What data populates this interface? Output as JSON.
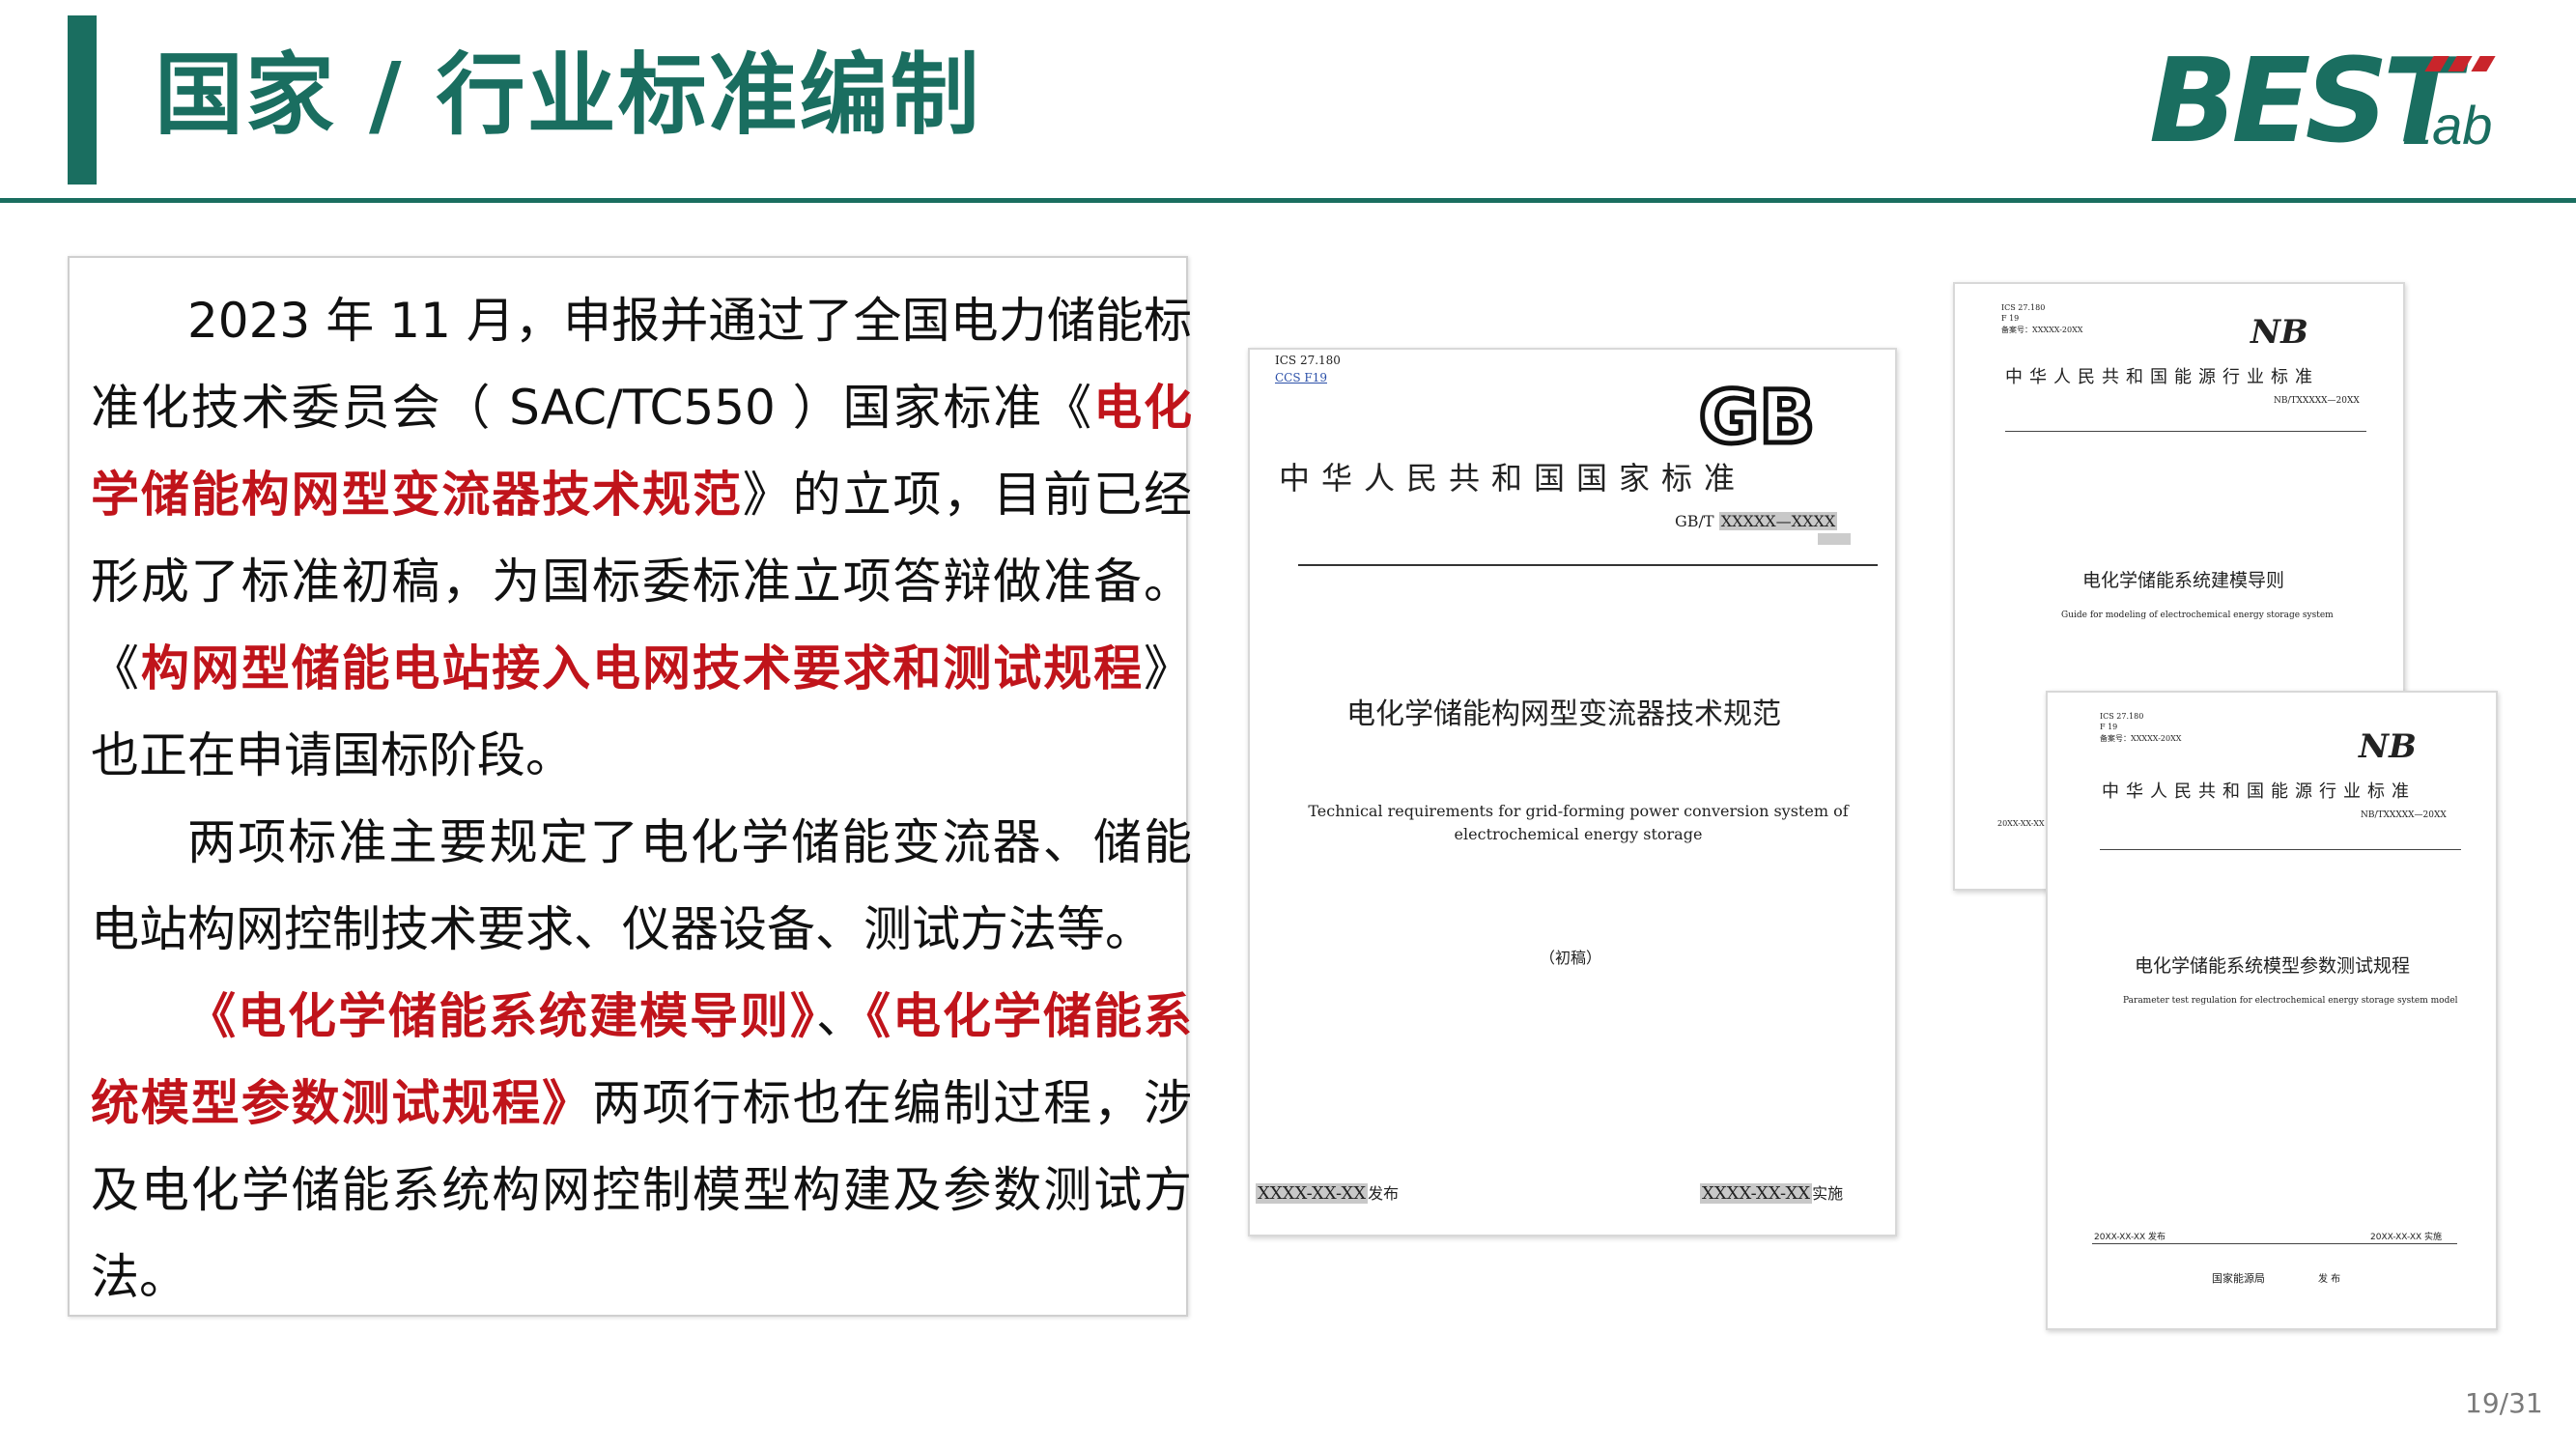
{
  "header": {
    "title": "国家 / 行业标准编制",
    "logo_text_main": "BEST",
    "logo_text_sub": "Lab",
    "accent_color": "#1a6e60",
    "logo_stripe_color": "#c9252b"
  },
  "body": {
    "p1": {
      "t1": "2023 年 11 月，申报并通过了全国电力储能标准化技术委员会（ SAC/TC550 ）国家标准《",
      "r1": "电化学储能构网型变流器技术规范",
      "t2": "》的立项，目前已经形成了标准初稿，为国标委标准立项答辩做准备。《",
      "r2": "构网型储能电站接入电网技术要求和测试规程",
      "t3": "》也正在申请国标阶段。"
    },
    "p2": "两项标准主要规定了电化学储能变流器、储能电站构网控制技术要求、仪器设备、测试方法等。",
    "p3": {
      "r1": "《电化学储能系统建模导则》",
      "t1": "、",
      "r2": "《电化学储能系统模型参数测试规程》",
      "t2": "两项行标也在编制过程，涉及电化学储能系统构网控制模型构建及参数测试方法。"
    },
    "highlight_color": "#c0141b"
  },
  "documents": {
    "gb": {
      "ics": "ICS 27.180",
      "ccs": "CCS  F19",
      "logo": "GB",
      "authority": "中华人民共和国国家标准",
      "number_prefix": "GB/T",
      "number_value": "XXXXX—XXXX",
      "title_cn": "电化学储能构网型变流器技术规范",
      "title_en": "Technical requirements for grid-forming power conversion system of electrochemical energy storage",
      "draft_label": "（初稿）",
      "issue_date": "XXXX-XX-XX",
      "issue_label": "发布",
      "impl_date": "XXXX-XX-XX",
      "impl_label": "实施"
    },
    "nb1": {
      "ics": "ICS 27.180",
      "ccs": "F 19",
      "record": "备案号：XXXXX-20XX",
      "logo": "NB",
      "authority": "中华人民共和国能源行业标准",
      "number": "NB/TXXXXX—20XX",
      "title_cn": "电化学储能系统建模导则",
      "title_en": "Guide for modeling of electrochemical energy storage system",
      "issue_date_partial": "20XX-XX-XX"
    },
    "nb2": {
      "ics": "ICS 27.180",
      "ccs": "F 19",
      "record": "备案号：XXXXX-20XX",
      "logo": "NB",
      "authority": "中华人民共和国能源行业标准",
      "number": "NB/TXXXXX—20XX",
      "title_cn": "电化学储能系统模型参数测试规程",
      "title_en": "Parameter test regulation for electrochemical energy storage system model",
      "issue_date": "20XX-XX-XX 发布",
      "impl_date": "20XX-XX-XX 实施",
      "publisher": "国家能源局",
      "publish_label": "发 布"
    }
  },
  "footer": {
    "page_number": "19/31"
  }
}
